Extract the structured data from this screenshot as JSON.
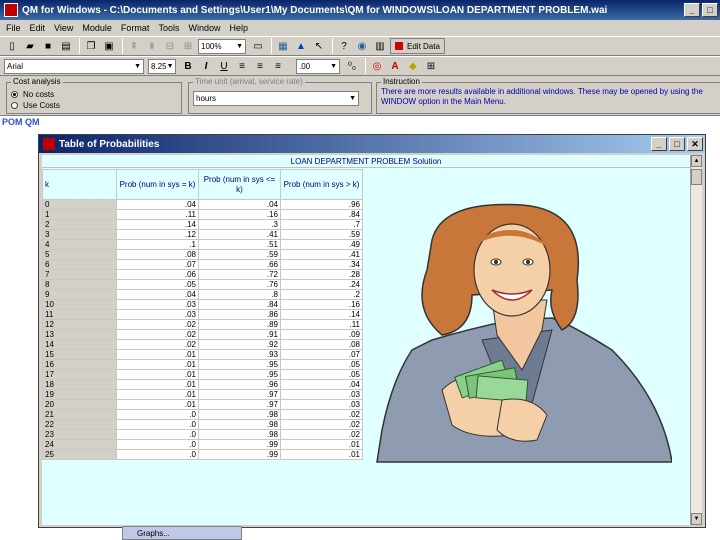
{
  "app": {
    "title": "QM for Windows - C:\\Documents and Settings\\User1\\My Documents\\QM for WINDOWS\\LOAN DEPARTMENT PROBLEM.wai"
  },
  "menu": [
    "File",
    "Edit",
    "View",
    "Module",
    "Format",
    "Tools",
    "Window",
    "Help"
  ],
  "toolbar": {
    "zoom": "100%",
    "edit_data": "Edit Data"
  },
  "format_bar": {
    "font": "Arial",
    "font_size": "8.25",
    "decimals": ".00"
  },
  "panel": {
    "cost_analysis_label": "Cost analysis",
    "no_costs": "No costs",
    "use_costs": "Use Costs",
    "time_unit_label": "Time unit (arrival, service rate)",
    "time_unit_value": "hours",
    "instruction_label": "Instruction",
    "instruction_text": "There are more results available in additional windows. These may be opened by using the WINDOW option in the Main Menu."
  },
  "pomqm_logo": "POM QM",
  "window": {
    "title": "Table of Probabilities",
    "sheet_title": "LOAN DEPARTMENT PROBLEM Solution",
    "columns": [
      "k",
      "Prob (num in sys = k)",
      "Prob (num in sys <= k)",
      "Prob (num in sys > k)"
    ],
    "rows": [
      [
        "0",
        ".04",
        ".04",
        ".96"
      ],
      [
        "1",
        ".11",
        ".16",
        ".84"
      ],
      [
        "2",
        ".14",
        ".3",
        ".7"
      ],
      [
        "3",
        ".12",
        ".41",
        ".59"
      ],
      [
        "4",
        ".1",
        ".51",
        ".49"
      ],
      [
        "5",
        ".08",
        ".59",
        ".41"
      ],
      [
        "6",
        ".07",
        ".66",
        ".34"
      ],
      [
        "7",
        ".06",
        ".72",
        ".28"
      ],
      [
        "8",
        ".05",
        ".76",
        ".24"
      ],
      [
        "9",
        ".04",
        ".8",
        ".2"
      ],
      [
        "10",
        ".03",
        ".84",
        ".16"
      ],
      [
        "11",
        ".03",
        ".86",
        ".14"
      ],
      [
        "12",
        ".02",
        ".89",
        ".11"
      ],
      [
        "13",
        ".02",
        ".91",
        ".09"
      ],
      [
        "14",
        ".02",
        ".92",
        ".08"
      ],
      [
        "15",
        ".01",
        ".93",
        ".07"
      ],
      [
        "16",
        ".01",
        ".95",
        ".05"
      ],
      [
        "17",
        ".01",
        ".95",
        ".05"
      ],
      [
        "18",
        ".01",
        ".96",
        ".04"
      ],
      [
        "19",
        ".01",
        ".97",
        ".03"
      ],
      [
        "20",
        ".01",
        ".97",
        ".03"
      ],
      [
        "21",
        ".0",
        ".98",
        ".02"
      ],
      [
        "22",
        ".0",
        ".98",
        ".02"
      ],
      [
        "23",
        ".0",
        ".98",
        ".02"
      ],
      [
        "24",
        ".0",
        ".99",
        ".01"
      ],
      [
        "25",
        ".0",
        ".99",
        ".01"
      ]
    ]
  },
  "taskbar": {
    "graphs_button": "Graphs..."
  },
  "colors": {
    "title_bar": "#0a246a",
    "grid_bg": "#e0ffff",
    "header_text": "#000080"
  }
}
